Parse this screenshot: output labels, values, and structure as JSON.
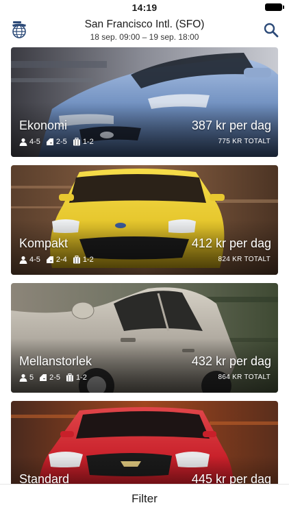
{
  "status_bar": {
    "time": "14:19"
  },
  "header": {
    "title": "San Francisco Intl. (SFO)",
    "subtitle": "18 sep. 09:00 – 19 sep. 18:00",
    "left_icon": "globe-icon",
    "right_icon": "search-icon"
  },
  "cars": [
    {
      "class": "Ekonomi",
      "price": "387 kr per dag",
      "total": "775 KR TOTALT",
      "passengers": "4-5",
      "doors": "2-5",
      "bags": "1-2",
      "color": "#6f8fbf"
    },
    {
      "class": "Kompakt",
      "price": "412 kr per dag",
      "total": "824 KR TOTALT",
      "passengers": "4-5",
      "doors": "2-4",
      "bags": "1-2",
      "color": "#e4c42a"
    },
    {
      "class": "Mellanstorlek",
      "price": "432 kr per dag",
      "total": "864 KR TOTALT",
      "passengers": "5",
      "doors": "2-5",
      "bags": "1-2",
      "color": "#b0aaa0"
    },
    {
      "class": "Standard",
      "price": "445 kr per dag",
      "total": "",
      "passengers": "",
      "doors": "",
      "bags": "",
      "color": "#c8202a"
    }
  ],
  "bottom": {
    "filter_label": "Filter"
  },
  "colors": {
    "text": "#1a1a1a",
    "card_text": "#ffffff",
    "background": "#ffffff"
  }
}
